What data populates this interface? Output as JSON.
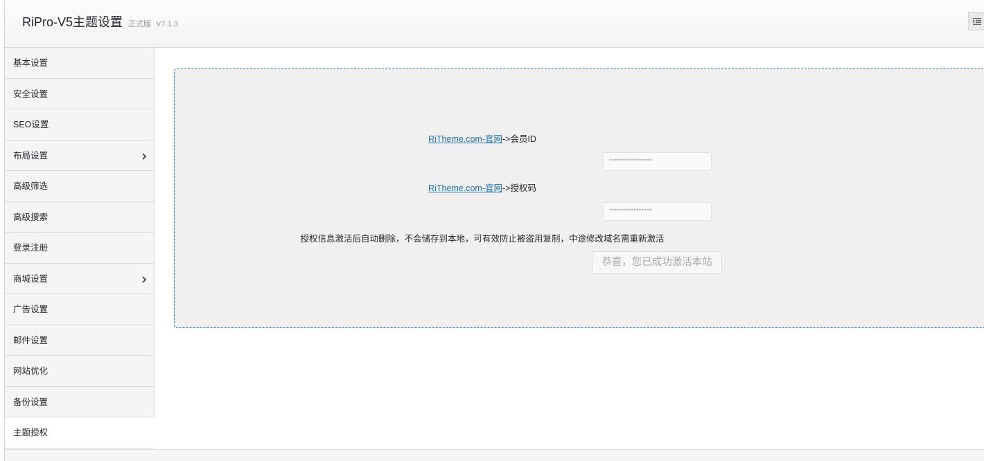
{
  "header": {
    "title": "RiPro-V5主题设置",
    "edition": "正式版",
    "version": "V7.1.3",
    "expand_icon": "list-collapse-icon"
  },
  "sidebar": {
    "items": [
      {
        "label": "基本设置",
        "has_submenu": false,
        "active": false
      },
      {
        "label": "安全设置",
        "has_submenu": false,
        "active": false
      },
      {
        "label": "SEO设置",
        "has_submenu": false,
        "active": false
      },
      {
        "label": "布局设置",
        "has_submenu": true,
        "active": false
      },
      {
        "label": "高级筛选",
        "has_submenu": false,
        "active": false
      },
      {
        "label": "高级搜索",
        "has_submenu": false,
        "active": false
      },
      {
        "label": "登录注册",
        "has_submenu": false,
        "active": false
      },
      {
        "label": "商城设置",
        "has_submenu": true,
        "active": false
      },
      {
        "label": "广告设置",
        "has_submenu": false,
        "active": false
      },
      {
        "label": "邮件设置",
        "has_submenu": false,
        "active": false
      },
      {
        "label": "网站优化",
        "has_submenu": false,
        "active": false
      },
      {
        "label": "备份设置",
        "has_submenu": false,
        "active": false
      },
      {
        "label": "主题授权",
        "has_submenu": false,
        "active": true
      }
    ]
  },
  "auth": {
    "member_link": "RiTheme.com-官网",
    "member_suffix": "->会员ID",
    "member_placeholder": "****************",
    "code_link": "RiTheme.com-官网",
    "code_suffix": "->授权码",
    "code_placeholder": "****************",
    "notice": "授权信息激活后自动删除，不会储存到本地，可有效防止被盗用复制，中途修改域名需重新激活",
    "success_label": "恭喜，您已成功激活本站"
  },
  "colors": {
    "link": "#2271b1",
    "panel_border": "#2271b1",
    "panel_bg": "#f0f0f0",
    "sidebar_bg": "#f5f5f5"
  }
}
